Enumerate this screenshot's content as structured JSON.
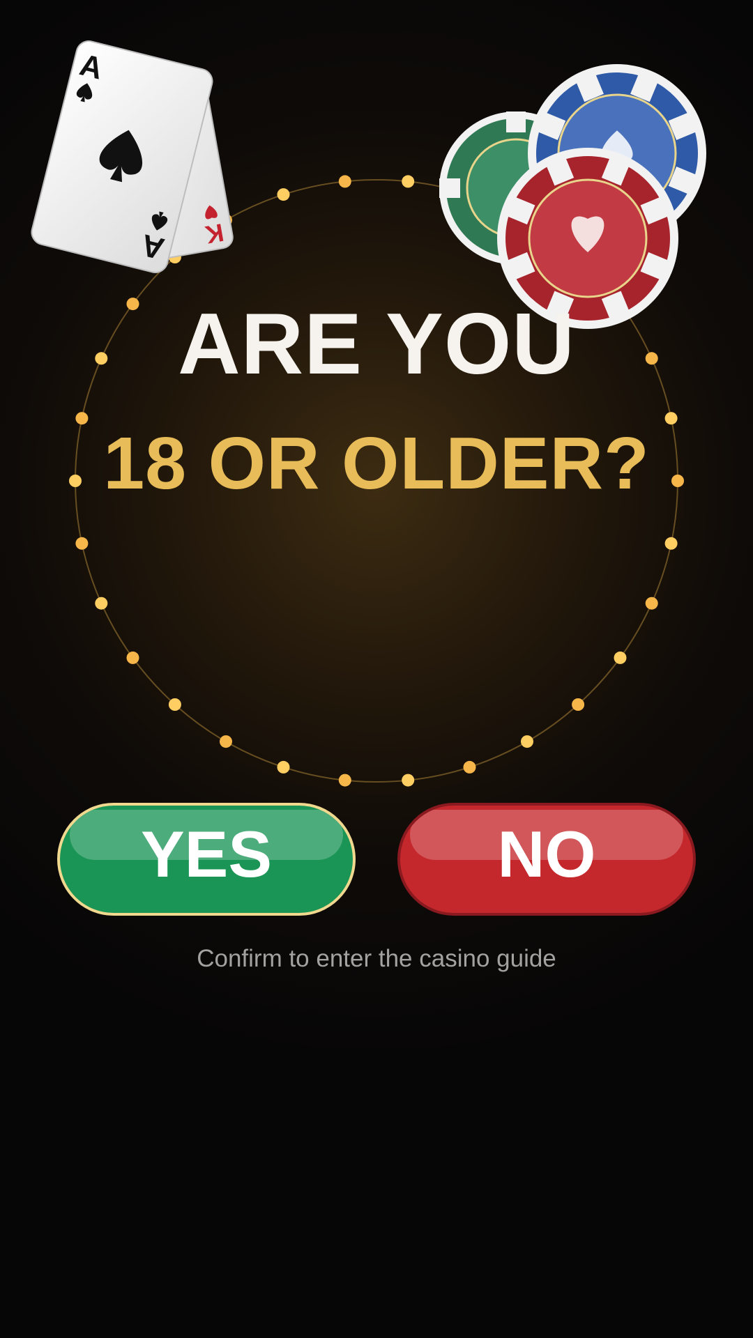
{
  "prompt": {
    "line1": "ARE YOU",
    "line2": "18 OR OLDER?"
  },
  "buttons": {
    "yes_label": "YES",
    "no_label": "NO"
  },
  "footer": {
    "confirm_text": "Confirm to enter the casino guide"
  },
  "decor": {
    "cards": [
      {
        "rank": "A",
        "suit": "spade-icon"
      },
      {
        "rank": "K",
        "suit": "heart-icon"
      }
    ],
    "chips": [
      {
        "color": "#2f7a55",
        "suit": "club"
      },
      {
        "color": "#2f5aa8",
        "suit": "spade-icon"
      },
      {
        "color": "#a8242d",
        "suit": "heart-icon"
      }
    ]
  },
  "colors": {
    "accent_gold": "#e8bc58",
    "yes_green": "#1b9556",
    "no_red": "#c5282c",
    "background": "#070607"
  }
}
